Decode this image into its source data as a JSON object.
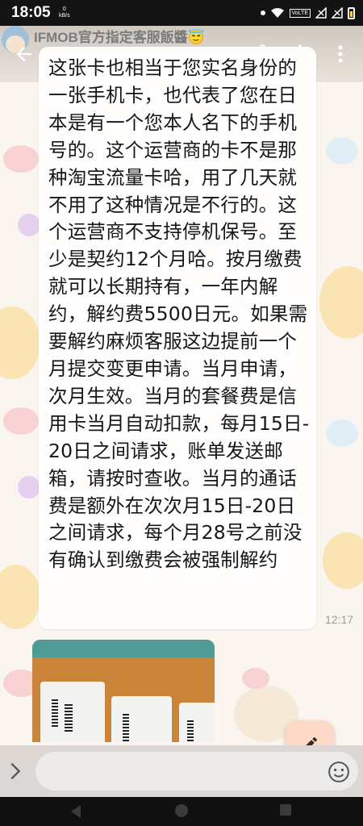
{
  "status_bar": {
    "time": "18:05",
    "speed_value": "0",
    "speed_unit": "kB/s",
    "volte": "VoLTE"
  },
  "header": {
    "title": "IFMOB官方指定客服飯醬😇"
  },
  "message": {
    "text": "这张卡也相当于您实名身份的一张手机卡，也代表了您在日本是有一个您本人名下的手机号的。这个运营商的卡不是那种淘宝流量卡哈，用了几天就不用了这种情况是不行的。这个运营商不支持停机保号。至少是契约12个月哈。按月缴费就可以长期持有，一年内解约，解约费5500日元。如果需要解约麻烦客服这边提前一个月提交变更申请。当月申请，次月生效。当月的套餐费是信用卡当月自动扣款，每月15日-20日之间请求，账单发送邮箱，请按时查收。当月的通话费是额外在次次月15日-20日之间请求，每个月28号之前没有确认到缴费会被强制解约",
    "time": "12:17"
  },
  "icons": {
    "back": "arrow-left-icon",
    "share": "share-icon",
    "star": "star-outline-icon",
    "more": "more-vert-icon",
    "fab": "pencil-icon",
    "expand": "chevron-right-icon",
    "emoji": "smiley-icon"
  },
  "colors": {
    "status_bar": "#141414",
    "fab_background": "#ffd9c7",
    "bubble": "#fffefd"
  }
}
